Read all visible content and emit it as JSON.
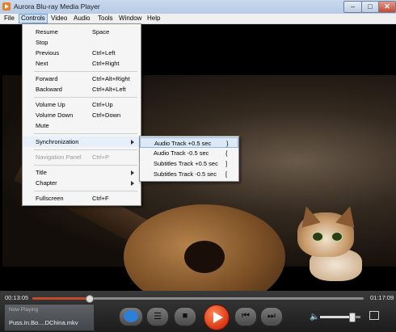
{
  "window": {
    "title": "Aurora Blu-ray Media Player",
    "min": "–",
    "max": "□",
    "close": "✕"
  },
  "menubar": {
    "items": [
      "File",
      "Controls",
      "Video",
      "Audio",
      "Tools",
      "Window",
      "Help"
    ],
    "active": "Controls"
  },
  "controls_menu": {
    "items": [
      {
        "label": "Resume",
        "shortcut": "Space"
      },
      {
        "label": "Stop",
        "shortcut": ""
      },
      {
        "label": "Previous",
        "shortcut": "Ctrl+Left"
      },
      {
        "label": "Next",
        "shortcut": "Ctrl+Right"
      },
      {
        "label": "Forward",
        "shortcut": "Ctrl+Alt+Right"
      },
      {
        "label": "Backward",
        "shortcut": "Ctrl+Alt+Left"
      },
      {
        "label": "Volume Up",
        "shortcut": "Ctrl+Up"
      },
      {
        "label": "Volume Down",
        "shortcut": "Ctrl+Down"
      },
      {
        "label": "Mute",
        "shortcut": ""
      },
      {
        "label": "Synchronization",
        "shortcut": ""
      },
      {
        "label": "Navigation Panel",
        "shortcut": "Ctrl+P"
      },
      {
        "label": "Title",
        "shortcut": ""
      },
      {
        "label": "Chapter",
        "shortcut": ""
      },
      {
        "label": "Fullscreen",
        "shortcut": "Ctrl+F"
      }
    ]
  },
  "sync_submenu": {
    "items": [
      {
        "label": "Audio Track +0.5 sec",
        "shortcut": "}"
      },
      {
        "label": "Audio Track -0.5 sec",
        "shortcut": "{"
      },
      {
        "label": "Subtitles Track +0.5 sec",
        "shortcut": "]"
      },
      {
        "label": "Subtitles Track -0.5 sec",
        "shortcut": "["
      }
    ]
  },
  "player": {
    "elapsed": "00:13:05",
    "total": "01:17:09",
    "progress": 0.17,
    "volume": 0.78,
    "now_playing_label": "Now Playing",
    "now_playing_file": "Puss.In.Bo....DChina.mkv"
  },
  "icons": {
    "playlist": "playlist-icon",
    "stop": "stop-icon",
    "play": "play-icon",
    "prev": "skip-previous-icon",
    "next": "skip-next-icon",
    "volume": "volume-icon",
    "fullscreen": "fullscreen-icon",
    "chat": "chat-icon"
  },
  "colors": {
    "accent": "#e0401a",
    "progress": "#c24a2a",
    "menu_highlight": "#dce9f8"
  }
}
